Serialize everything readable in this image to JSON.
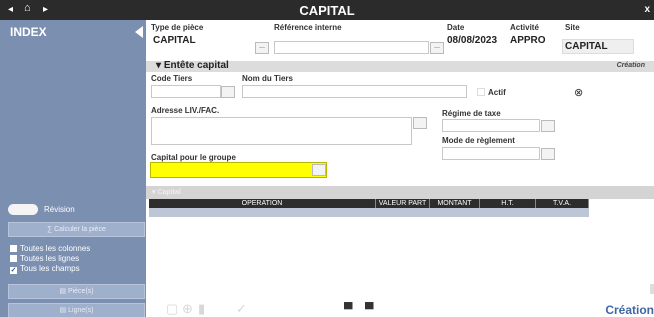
{
  "window": {
    "title": "CAPITAL",
    "close_glyph": "x",
    "nav_back": "◂",
    "nav_home": "⌂",
    "nav_forward": "▸"
  },
  "sidebar": {
    "title": "INDEX",
    "revision_label": "Révision",
    "calc_button": "Calculer la pièce",
    "checkboxes": [
      {
        "label": "Toutes les colonnes",
        "checked": false
      },
      {
        "label": "Toutes les lignes",
        "checked": false
      },
      {
        "label": "Tous les champs",
        "checked": true
      }
    ],
    "piece_button": "Pièce(s)",
    "ligne_button": "Ligne(s)"
  },
  "header": {
    "type_piece_label": "Type de pièce",
    "type_piece_value": "CAPITAL",
    "reference_label": "Référence interne",
    "reference_value": "",
    "date_label": "Date",
    "date_value": "08/08/2023",
    "activite_label": "Activité",
    "activite_value": "APPRO",
    "site_label": "Site",
    "site_value": "CAPITAL",
    "dots": "..."
  },
  "entete": {
    "title": "Entête capital",
    "mode": "Création",
    "code_tiers_label": "Code Tiers",
    "nom_tiers_label": "Nom du Tiers",
    "actif_label": "Actif",
    "adresse_label": "Adresse LIV./FAC.",
    "regime_label": "Régime de taxe",
    "mode_reglement_label": "Mode de règlement",
    "capital_groupe_label": "Capital pour le groupe"
  },
  "grid": {
    "section_label": "Capital",
    "columns": [
      "OPERATION",
      "VALEUR PART",
      "MONTANT",
      "H.T.",
      "T.V.A."
    ]
  },
  "footer": {
    "mode_label": "Création"
  }
}
